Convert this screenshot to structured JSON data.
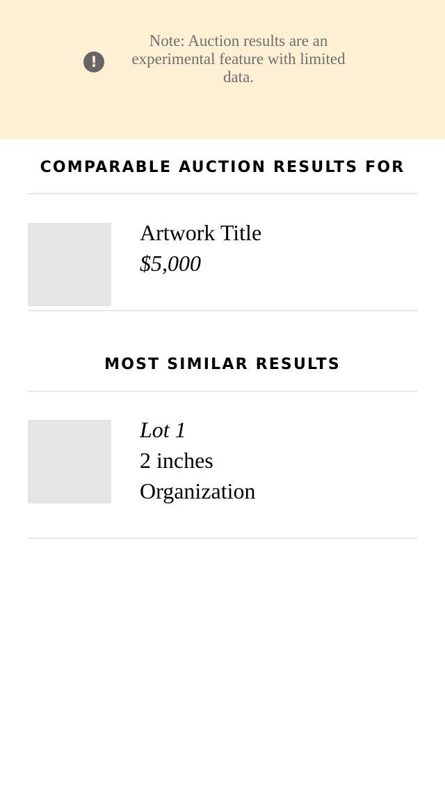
{
  "notice": {
    "icon": "exclamation-circle-icon",
    "text": "Note: Auction results are an experimental feature with limited data."
  },
  "comparable": {
    "heading": "COMPARABLE AUCTION RESULTS FOR",
    "artwork": {
      "title": "Artwork Title",
      "price": "$5,000"
    }
  },
  "similar": {
    "heading": "MOST SIMILAR RESULTS",
    "results": [
      {
        "lot": "Lot 1",
        "size": "2 inches",
        "organization": "Organization"
      }
    ]
  }
}
